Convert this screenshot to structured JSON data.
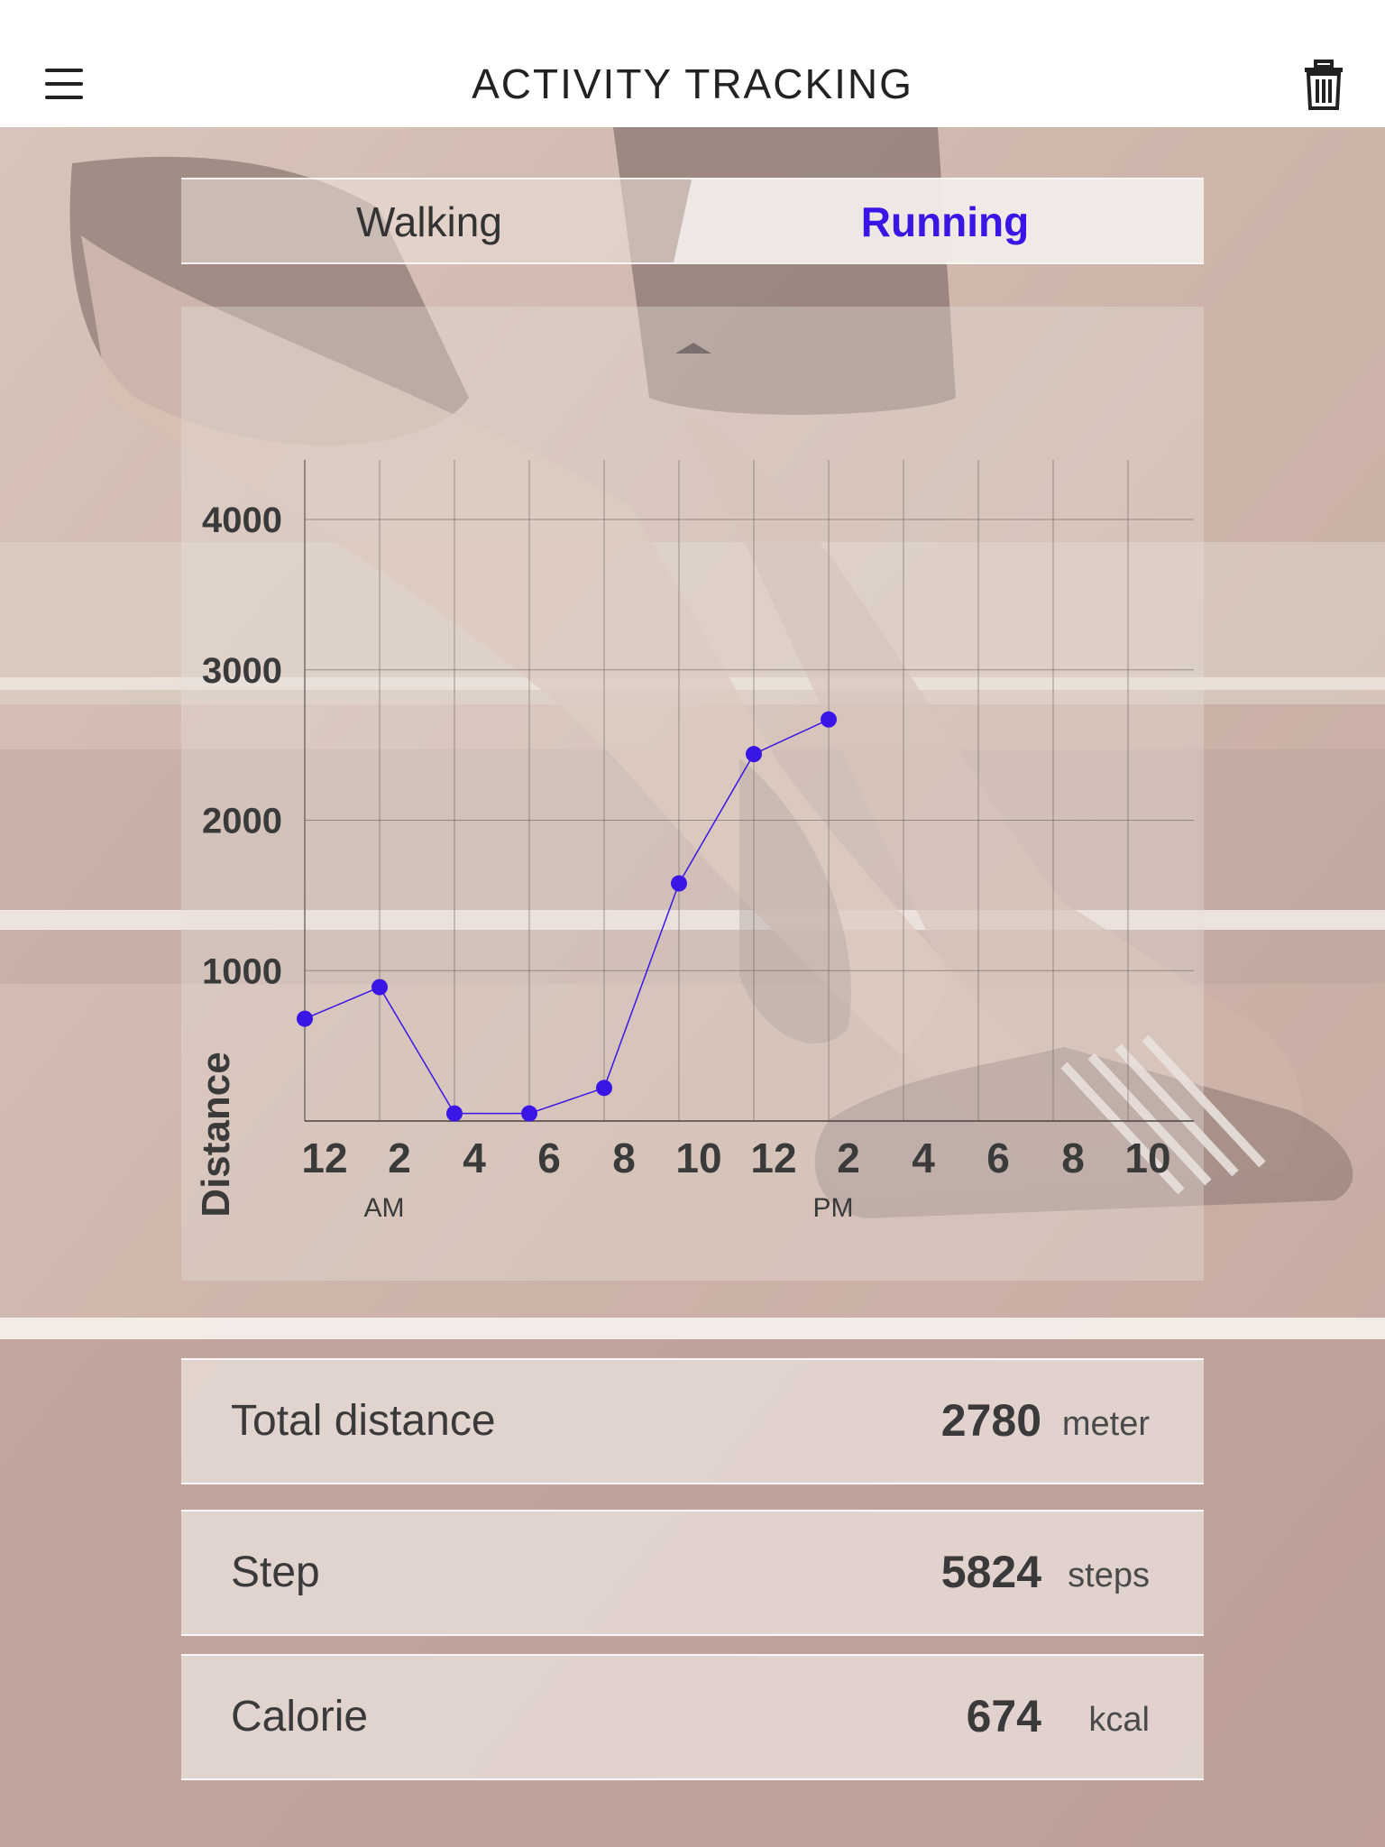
{
  "header": {
    "title": "ACTIVITY TRACKING",
    "menu_icon": "hamburger-menu-icon",
    "delete_icon": "trash-icon"
  },
  "tabs": [
    {
      "label": "Walking",
      "active": false
    },
    {
      "label": "Running",
      "active": true
    }
  ],
  "colors": {
    "accent": "#3a16e6",
    "text": "#3a3a3a"
  },
  "chart_data": {
    "type": "line",
    "ylabel": "Distance",
    "ylim": [
      0,
      4000
    ],
    "y_ticks": [
      1000,
      2000,
      3000,
      4000
    ],
    "x_tick_labels": [
      "12",
      "2",
      "4",
      "6",
      "8",
      "10",
      "12",
      "2",
      "4",
      "6",
      "8",
      "10"
    ],
    "x_period_labels": [
      "AM",
      "PM"
    ],
    "grid": true,
    "series": [
      {
        "x_index": [
          0,
          1,
          2,
          3,
          4,
          5,
          6,
          7
        ],
        "values": [
          680,
          890,
          50,
          50,
          220,
          1580,
          2440,
          2670
        ]
      }
    ]
  },
  "stats": [
    {
      "label": "Total distance",
      "value": "2780",
      "unit": "meter"
    },
    {
      "label": "Step",
      "value": "5824",
      "unit": "steps"
    },
    {
      "label": "Calorie",
      "value": "674",
      "unit": "kcal"
    }
  ]
}
